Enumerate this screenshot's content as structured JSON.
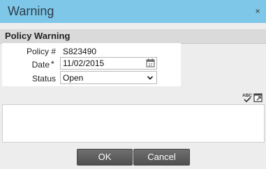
{
  "window": {
    "title": "Warning",
    "close_glyph": "×"
  },
  "section": {
    "title": "Policy Warning"
  },
  "form": {
    "policy_label": "Policy #",
    "policy_value": "S823490",
    "date_label": "Date",
    "date_required_mark": "*",
    "date_value": "11/02/2015",
    "status_label": "Status",
    "status_value": "Open"
  },
  "icons": {
    "close": "close-icon",
    "calendar": "calendar-icon",
    "dropdown": "chevron-down-icon",
    "spellcheck": "spellcheck-icon",
    "expand": "expand-icon"
  },
  "buttons": {
    "ok": "OK",
    "cancel": "Cancel"
  },
  "colors": {
    "titlebar": "#7fc7e8",
    "required": "#c8102e",
    "button": "#5f5f5f"
  }
}
